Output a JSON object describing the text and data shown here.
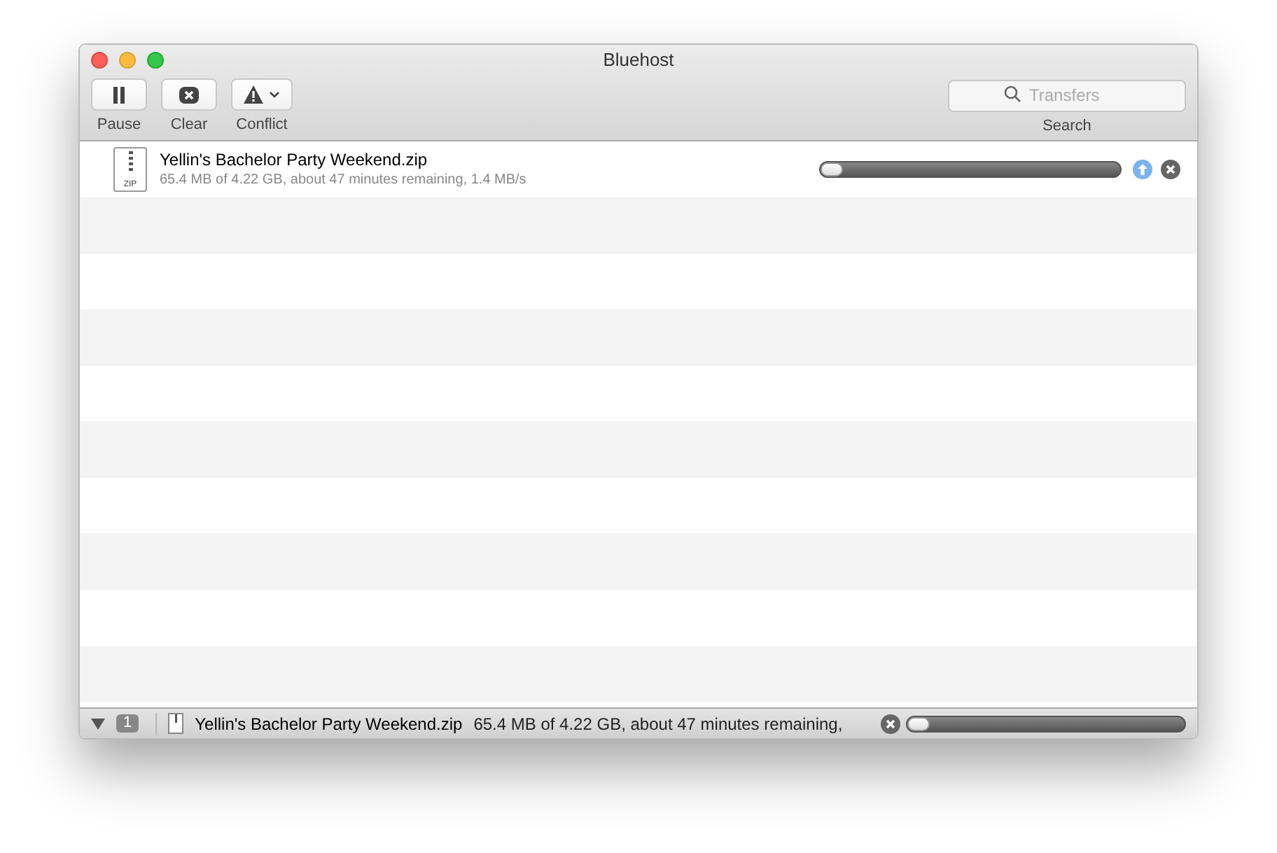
{
  "window": {
    "title": "Bluehost"
  },
  "toolbar": {
    "buttons": [
      {
        "kind": "pause",
        "label": "Pause"
      },
      {
        "kind": "clear",
        "label": "Clear"
      },
      {
        "kind": "conflict",
        "label": "Conflict"
      }
    ],
    "search": {
      "placeholder": "Transfers",
      "label": "Search"
    }
  },
  "transfers": [
    {
      "name": "Yellin's Bachelor Party Weekend.zip",
      "file_badge": "ZIP",
      "detail": "65.4 MB of 4.22 GB, about 47 minutes remaining, 1.4 MB/s",
      "level": 0.015
    }
  ],
  "status_bar": {
    "count": "1",
    "name": "Yellin's Bachelor Party Weekend.zip",
    "detail": "65.4 MB of 4.22 GB, about 47 minutes remaining,",
    "level": 0.015
  }
}
